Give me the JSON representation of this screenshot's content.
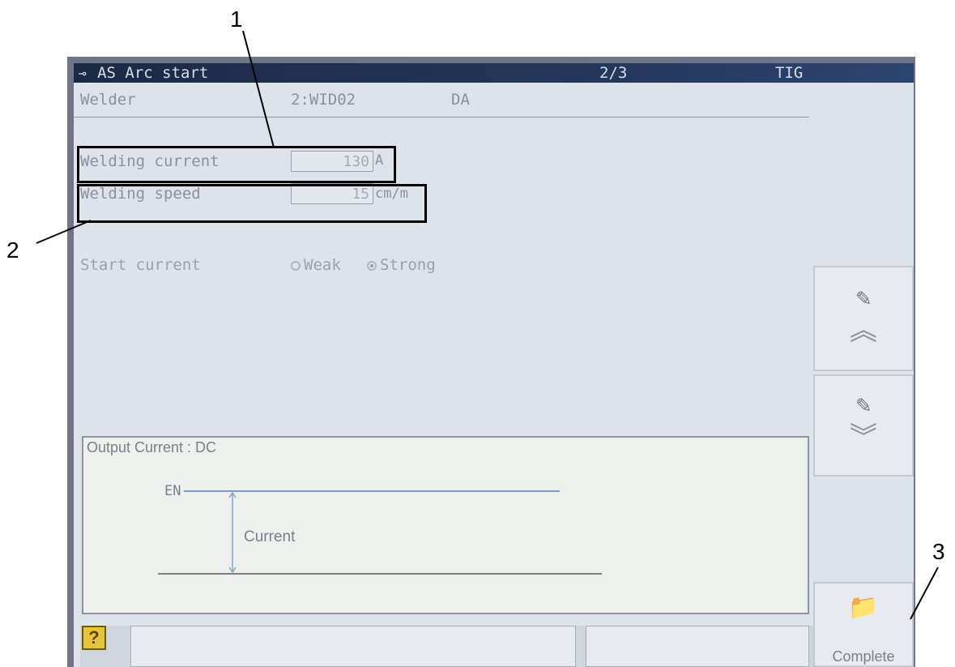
{
  "callouts": {
    "c1": "1",
    "c2": "2",
    "c3": "3"
  },
  "titlebar": {
    "title": "AS Arc start",
    "page": "2/3",
    "mode": "TIG"
  },
  "header": {
    "label": "Welder",
    "welder_id": "2:WID02",
    "welder_type": "DA"
  },
  "fields": {
    "welding_current": {
      "label": "Welding current",
      "value": "130",
      "unit": "A"
    },
    "welding_speed": {
      "label": "Welding speed",
      "value": "15",
      "unit": "cm/m"
    }
  },
  "start_current": {
    "label": "Start current",
    "options": [
      "Weak",
      "Strong"
    ],
    "selected": "Strong"
  },
  "output": {
    "title": "Output Current : DC",
    "en_label": "EN",
    "current_label": "Current"
  },
  "side_buttons": {
    "complete_label": "Complete"
  },
  "icons": {
    "help": "?"
  },
  "colors": {
    "titlebar": "#1b2a44",
    "screen_bg": "#dde3ea",
    "bezel": "#6d7587",
    "help_icon": "#e8c43a"
  }
}
